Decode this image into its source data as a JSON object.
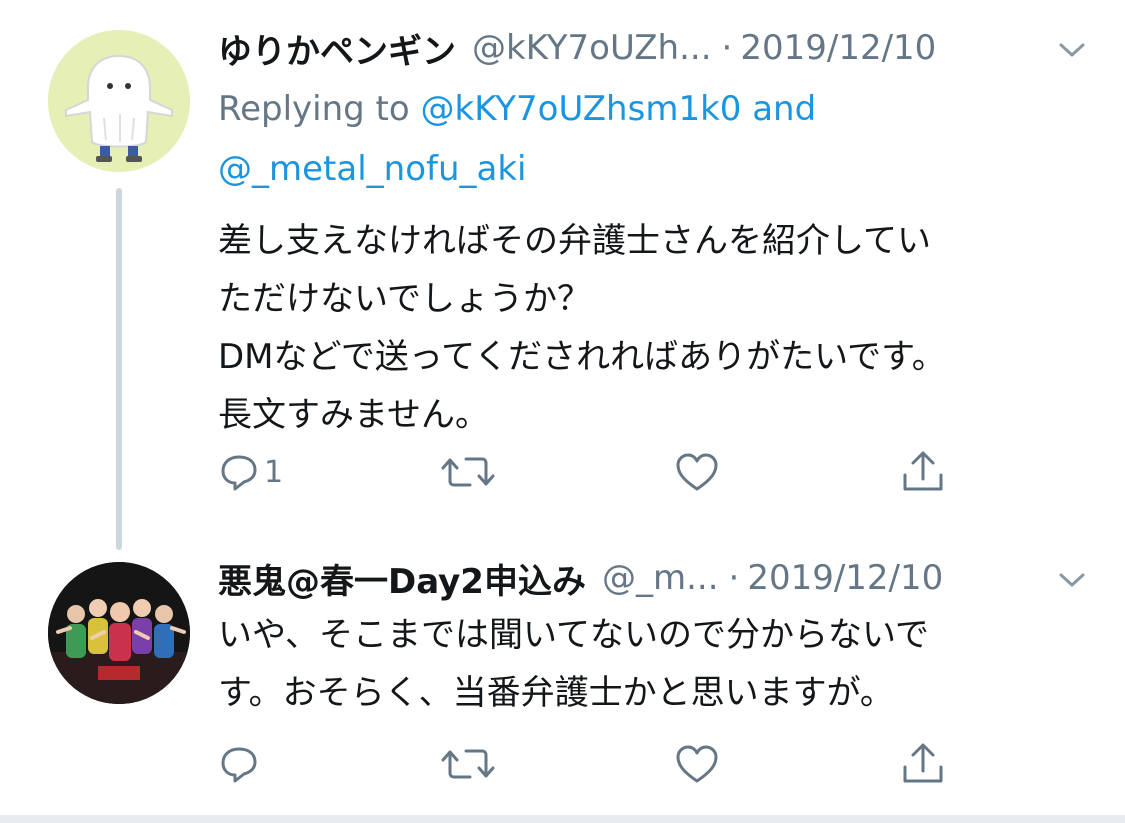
{
  "tweets": [
    {
      "display_name": "ゆりかペンギン",
      "handle": "@kKY7oUZh...",
      "separator": "·",
      "date": "2019/12/10",
      "replying_to_prefix": "Replying to",
      "replying_to_user1": "@kKY7oUZhsm1k0",
      "replying_to_and": "and",
      "replying_to_user2": "@_metal_nofu_aki",
      "lines": [
        "差し支えなければその弁護士さんを紹介してい",
        "ただけないでしょうか？",
        "DMなどで送ってくだされればありがたいです。",
        "長文すみません。"
      ],
      "reply_count": "1",
      "avatar_icon": "ghost-avatar"
    },
    {
      "display_name": "悪鬼@春一Day2申込み",
      "handle": "@_m...",
      "separator": "·",
      "date": "2019/12/10",
      "lines": [
        "いや、そこまでは聞いてないので分からないで",
        "す。おそらく、当番弁護士かと思いますが。"
      ],
      "reply_count": "",
      "avatar_icon": "group-photo-avatar"
    }
  ],
  "icons": {
    "reply": "reply-icon",
    "retweet": "retweet-icon",
    "like": "heart-icon",
    "share": "share-icon",
    "more": "chevron-down-icon"
  },
  "colors": {
    "text": "#14171a",
    "muted": "#657786",
    "link": "#1b95e0",
    "thread_line": "#ccd6dd",
    "avatar1_bg": "#e8f0b8"
  }
}
